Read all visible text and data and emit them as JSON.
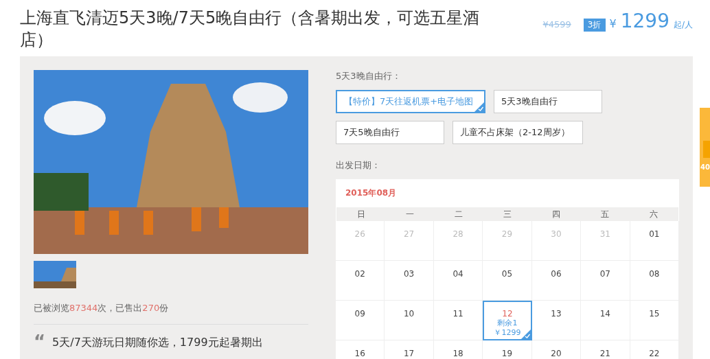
{
  "title": "上海直飞清迈5天3晚/7天5晚自由行（含暑期出发，可选五星酒店）",
  "price": {
    "original": "¥4599",
    "discount": "3折",
    "currency": "¥",
    "amount": "1299",
    "unit": "起/人"
  },
  "stats": {
    "prefix": "已被浏览",
    "views": "87344",
    "middle": "次，已售出",
    "sold": "270",
    "suffix": "份"
  },
  "quote": {
    "mark": "“",
    "text": "5天/7天游玩日期随你选，1799元起暑期出"
  },
  "package": {
    "label": "5天3晚自由行：",
    "options": [
      {
        "text": "【特价】7天往返机票+电子地图",
        "selected": true
      },
      {
        "text": "5天3晚自由行",
        "selected": false
      },
      {
        "text": "7天5晚自由行",
        "selected": false
      },
      {
        "text": "儿童不占床架（2-12周岁）",
        "selected": false
      }
    ]
  },
  "calendar": {
    "label": "出发日期：",
    "month": "2015年08月",
    "weekdays": [
      "日",
      "一",
      "二",
      "三",
      "四",
      "五",
      "六"
    ],
    "days": [
      {
        "day": "26",
        "muted": true,
        "selected": false
      },
      {
        "day": "27",
        "muted": true,
        "selected": false
      },
      {
        "day": "28",
        "muted": true,
        "selected": false
      },
      {
        "day": "29",
        "muted": true,
        "selected": false
      },
      {
        "day": "30",
        "muted": true,
        "selected": false
      },
      {
        "day": "31",
        "muted": true,
        "selected": false
      },
      {
        "day": "01",
        "muted": false,
        "selected": false
      },
      {
        "day": "02",
        "muted": false,
        "selected": false
      },
      {
        "day": "03",
        "muted": false,
        "selected": false
      },
      {
        "day": "04",
        "muted": false,
        "selected": false
      },
      {
        "day": "05",
        "muted": false,
        "selected": false
      },
      {
        "day": "06",
        "muted": false,
        "selected": false
      },
      {
        "day": "07",
        "muted": false,
        "selected": false
      },
      {
        "day": "08",
        "muted": false,
        "selected": false
      },
      {
        "day": "09",
        "muted": false,
        "selected": false
      },
      {
        "day": "10",
        "muted": false,
        "selected": false
      },
      {
        "day": "11",
        "muted": false,
        "selected": false
      },
      {
        "day": "12",
        "muted": false,
        "selected": true,
        "remaining": "剩余1",
        "price": "￥1299"
      },
      {
        "day": "13",
        "muted": false,
        "selected": false
      },
      {
        "day": "14",
        "muted": false,
        "selected": false
      },
      {
        "day": "15",
        "muted": false,
        "selected": false
      },
      {
        "day": "16",
        "muted": false,
        "selected": false
      },
      {
        "day": "17",
        "muted": false,
        "selected": false
      },
      {
        "day": "18",
        "muted": false,
        "selected": false
      },
      {
        "day": "19",
        "muted": false,
        "selected": false
      },
      {
        "day": "20",
        "muted": false,
        "selected": false
      },
      {
        "day": "21",
        "muted": false,
        "selected": false
      },
      {
        "day": "22",
        "muted": false,
        "selected": false
      }
    ]
  },
  "side_tab": {
    "text": "40"
  }
}
